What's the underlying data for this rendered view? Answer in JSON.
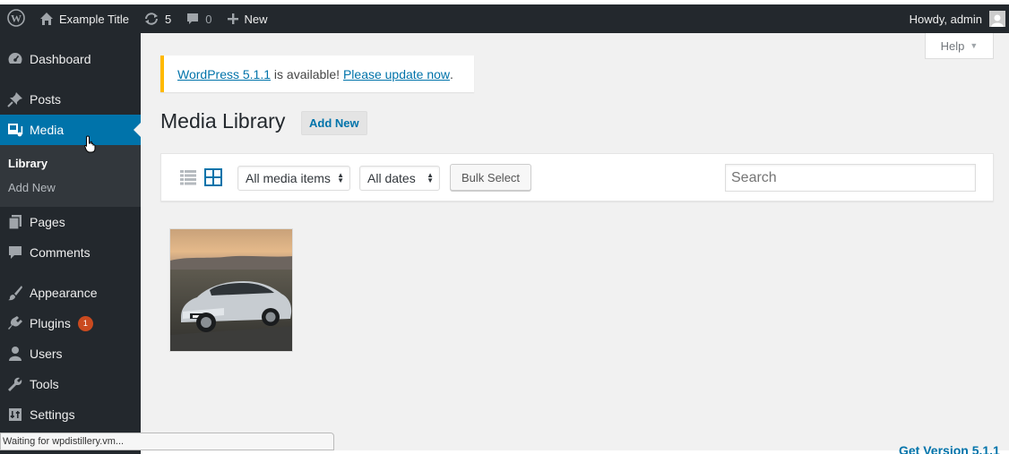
{
  "adminbar": {
    "site_title": "Example Title",
    "updates_count": "5",
    "comments_count": "0",
    "new_label": "New",
    "howdy": "Howdy, admin"
  },
  "sidebar": {
    "items": [
      {
        "label": "Dashboard",
        "icon": "dashboard-icon"
      },
      {
        "label": "Posts",
        "icon": "pin-icon"
      },
      {
        "label": "Media",
        "icon": "media-icon"
      },
      {
        "label": "Pages",
        "icon": "pages-icon"
      },
      {
        "label": "Comments",
        "icon": "comment-icon"
      },
      {
        "label": "Appearance",
        "icon": "brush-icon"
      },
      {
        "label": "Plugins",
        "icon": "plugin-icon",
        "badge": "1"
      },
      {
        "label": "Users",
        "icon": "user-icon"
      },
      {
        "label": "Tools",
        "icon": "wrench-icon"
      },
      {
        "label": "Settings",
        "icon": "settings-icon"
      }
    ],
    "submenu": [
      "Library",
      "Add New"
    ]
  },
  "help_label": "Help",
  "notice": {
    "version_link": "WordPress 5.1.1",
    "middle_text": " is available! ",
    "update_link": "Please update now",
    "end_text": "."
  },
  "page": {
    "title": "Media Library",
    "add_new": "Add New"
  },
  "toolbar": {
    "filter_type": "All media items",
    "filter_date": "All dates",
    "bulk_select": "Bulk Select",
    "search_placeholder": "Search"
  },
  "status_text": "Waiting for wpdistillery.vm...",
  "footer_link": "Get Version 5.1.1",
  "colors": {
    "adminbar_bg": "#23282d",
    "accent": "#0073aa",
    "notice_warning": "#ffb900",
    "badge": "#ca4a1f"
  }
}
